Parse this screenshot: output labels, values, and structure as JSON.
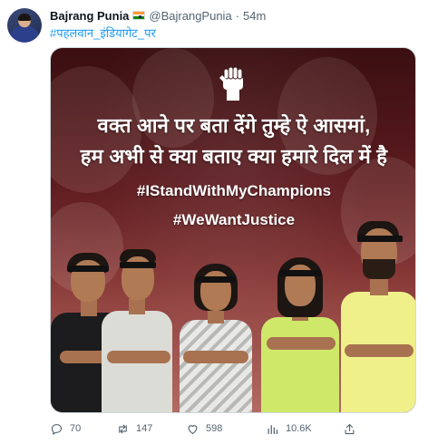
{
  "author": {
    "name": "Bajrang Punia",
    "flag": "indian-flag-icon",
    "handle": "@BajrangPunia",
    "separator": "·",
    "time": "54m"
  },
  "tweet": {
    "hashtag": "#पहलवान_इंडियागेट_पर"
  },
  "media": {
    "fist_icon": "raised-fist-icon",
    "poem_line_1": "वक्त आने पर बता देंगे तुम्हे ऐ आसमां,",
    "poem_line_2": "हम अभी से क्या बताए क्या हमारे दिल में है",
    "tag_1": "#IStandWithMyChampions",
    "tag_2": "#WeWantJustice"
  },
  "actions": {
    "replies": "70",
    "retweets": "147",
    "likes": "598",
    "views": "10.6K"
  },
  "colors": {
    "link": "#1d9bf0",
    "muted": "#536471",
    "jersey_green": "#cfe86a",
    "jersey_yellow": "#f0f08a"
  }
}
